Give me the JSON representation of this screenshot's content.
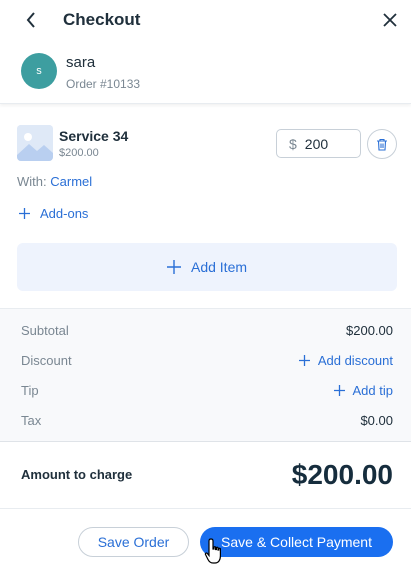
{
  "header": {
    "title": "Checkout",
    "back_icon": "chevron-left-icon",
    "close_icon": "close-icon"
  },
  "customer": {
    "initial": "s",
    "name": "sara",
    "order": "Order #10133",
    "avatar_color": "#3d9ea0"
  },
  "item": {
    "name": "Service 34",
    "price": "$200.00",
    "currency": "$",
    "amount": "200",
    "with_label": "With:",
    "staff": "Carmel",
    "addons_label": "Add-ons"
  },
  "add_item": {
    "label": "Add Item"
  },
  "summary": {
    "subtotal_label": "Subtotal",
    "subtotal_value": "$200.00",
    "discount_label": "Discount",
    "discount_action": "Add discount",
    "tip_label": "Tip",
    "tip_action": "Add tip",
    "tax_label": "Tax",
    "tax_value": "$0.00"
  },
  "total": {
    "label": "Amount to charge",
    "value": "$200.00"
  },
  "footer": {
    "save_order": "Save Order",
    "save_collect": "Save & Collect Payment"
  },
  "colors": {
    "accent": "#2a6fd6",
    "primary_button": "#1a6ff0",
    "text": "#20303c",
    "muted": "#7a8792"
  }
}
